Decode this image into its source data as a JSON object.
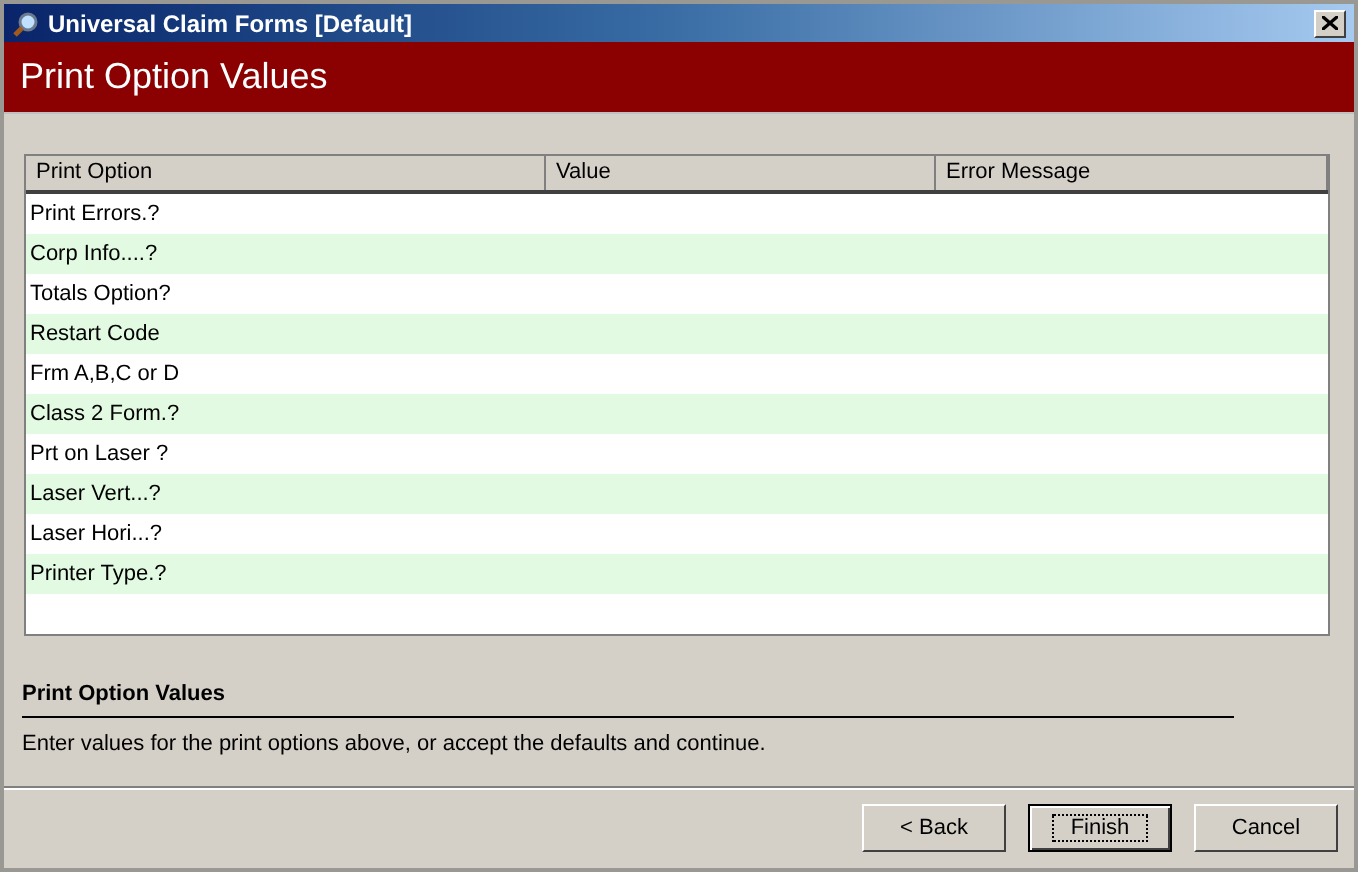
{
  "window": {
    "title": "Universal Claim Forms [Default]"
  },
  "header": {
    "title": "Print Option Values"
  },
  "table": {
    "columns": [
      "Print Option",
      "Value",
      "Error Message"
    ],
    "rows": [
      {
        "print_option": "Print Errors.?"
      },
      {
        "print_option": "Corp Info....?"
      },
      {
        "print_option": "Totals Option?"
      },
      {
        "print_option": "Restart Code"
      },
      {
        "print_option": "Frm A,B,C or D"
      },
      {
        "print_option": "Class 2 Form.?"
      },
      {
        "print_option": "Prt on Laser ?"
      },
      {
        "print_option": "Laser Vert...?"
      },
      {
        "print_option": "Laser Hori...?"
      },
      {
        "print_option": "Printer Type.?"
      }
    ]
  },
  "description": {
    "title": "Print Option Values",
    "text": "Enter values for the print options above, or accept the defaults and continue."
  },
  "buttons": [
    {
      "label": "< Back",
      "default": false
    },
    {
      "label": "Finish",
      "default": true
    },
    {
      "label": "Cancel",
      "default": false
    }
  ]
}
